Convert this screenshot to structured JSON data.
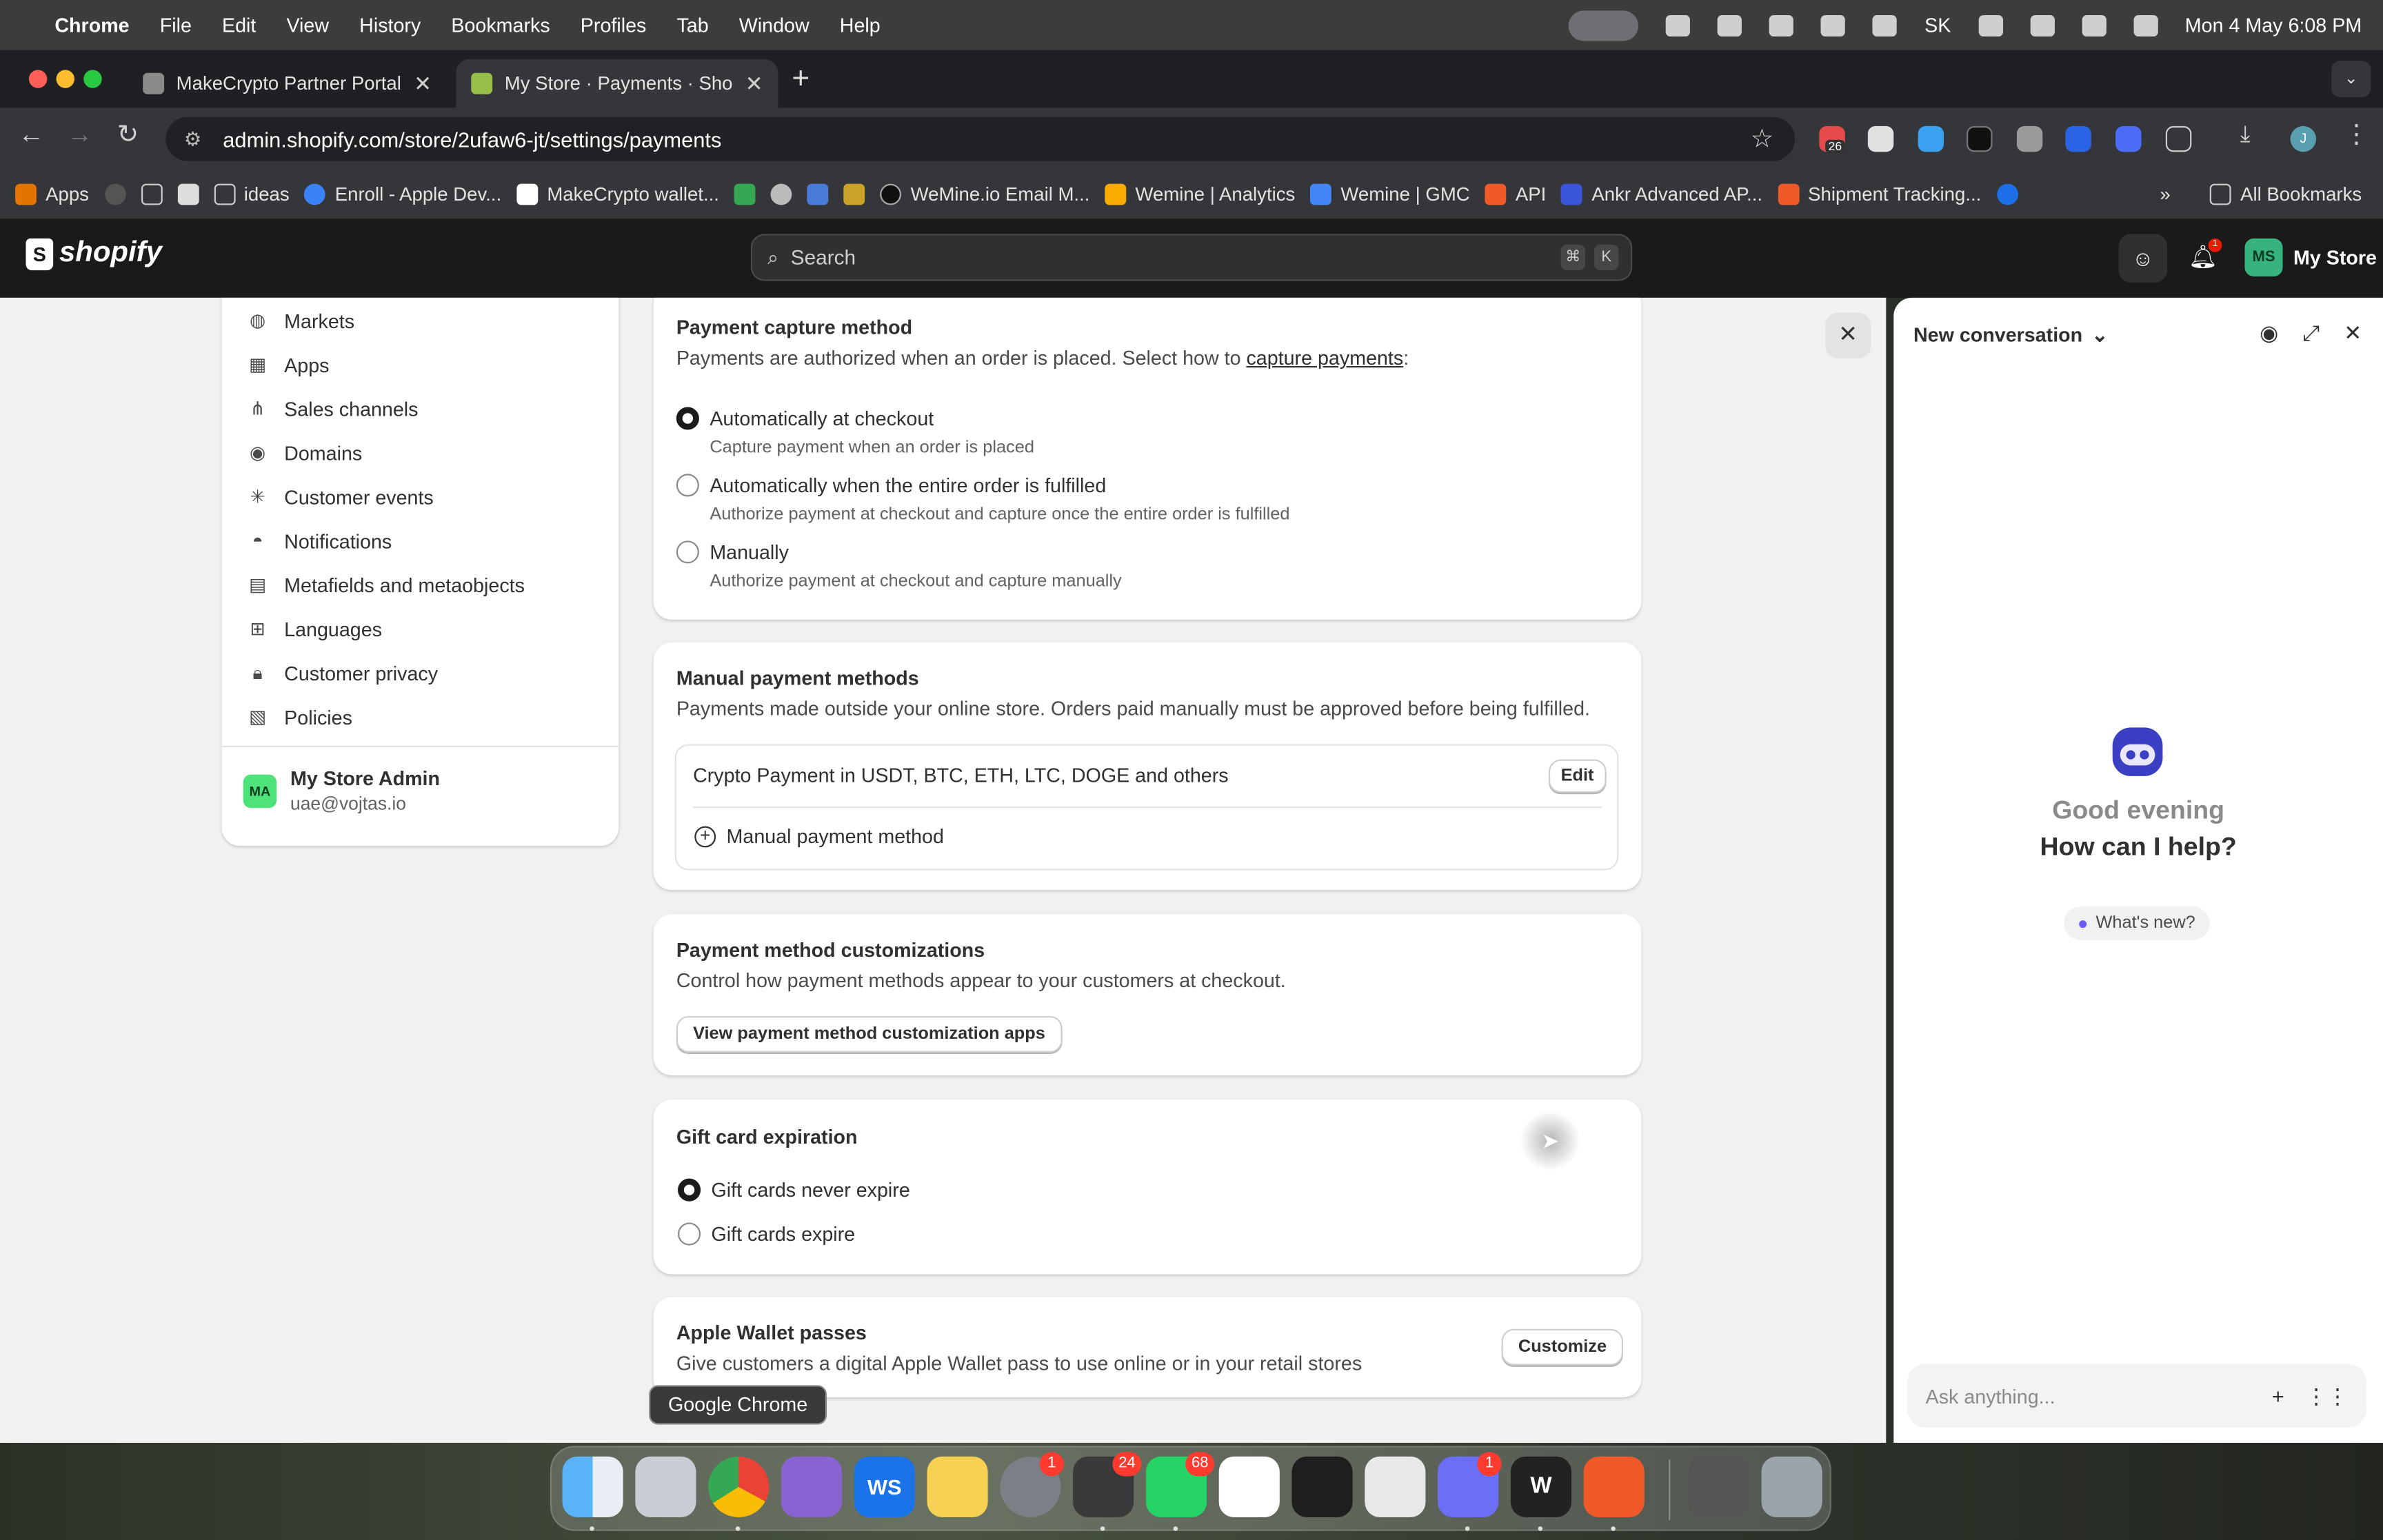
{
  "menubar": {
    "app": "Chrome",
    "items": [
      "File",
      "Edit",
      "View",
      "History",
      "Bookmarks",
      "Profiles",
      "Tab",
      "Window",
      "Help"
    ],
    "clock": "Mon 4 May  6:08 PM",
    "input_source": "SK"
  },
  "tabs": [
    {
      "title": "MakeCrypto Partner Portal"
    },
    {
      "title": "My Store · Payments · Shopify"
    }
  ],
  "address_bar": {
    "url": "admin.shopify.com/store/2ufaw6-jt/settings/payments"
  },
  "extensions": {
    "badge": "26"
  },
  "bookmarks": {
    "items": [
      "Apps",
      "ideas",
      "Enroll - Apple Dev...",
      "MakeCrypto wallet...",
      "WeMine.io Email M...",
      "Wemine | Analytics",
      "Wemine | GMC",
      "API",
      "Ankr Advanced AP...",
      "Shipment Tracking..."
    ],
    "all": "All Bookmarks"
  },
  "shopify": {
    "logo": "shopify",
    "search_placeholder": "Search",
    "shortcut": [
      "⌘",
      "K"
    ],
    "notifications_badge": "1",
    "store_initials": "MS",
    "store_name": "My Store"
  },
  "sidebar": {
    "items": [
      "Markets",
      "Apps",
      "Sales channels",
      "Domains",
      "Customer events",
      "Notifications",
      "Metafields and metaobjects",
      "Languages",
      "Customer privacy",
      "Policies"
    ],
    "admin": {
      "initials": "MA",
      "name": "My Store Admin",
      "email": "uae@vojtas.io"
    }
  },
  "capture": {
    "title": "Payment capture method",
    "desc_prefix": "Payments are authorized when an order is placed. Select how to ",
    "desc_link": "capture payments",
    "desc_suffix": ":",
    "options": [
      {
        "label": "Automatically at checkout",
        "help": "Capture payment when an order is placed",
        "selected": true
      },
      {
        "label": "Automatically when the entire order is fulfilled",
        "help": "Authorize payment at checkout and capture once the entire order is fulfilled",
        "selected": false
      },
      {
        "label": "Manually",
        "help": "Authorize payment at checkout and capture manually",
        "selected": false
      }
    ]
  },
  "manual": {
    "title": "Manual payment methods",
    "desc": "Payments made outside your online store. Orders paid manually must be approved before being fulfilled.",
    "method": "Crypto Payment in USDT, BTC, ETH, LTC, DOGE and others",
    "edit": "Edit",
    "add": "Manual payment method"
  },
  "customizations": {
    "title": "Payment method customizations",
    "desc": "Control how payment methods appear to your customers at checkout.",
    "button": "View payment method customization apps"
  },
  "giftcard": {
    "title": "Gift card expiration",
    "options": [
      {
        "label": "Gift cards never expire",
        "selected": true
      },
      {
        "label": "Gift cards expire",
        "selected": false
      }
    ]
  },
  "wallet": {
    "title": "Apple Wallet passes",
    "desc": "Give customers a digital Apple Wallet pass to use online or in your retail stores",
    "button": "Customize"
  },
  "sidekick": {
    "title": "New conversation",
    "greeting1": "Good evening",
    "greeting2": "How can I help?",
    "whats_new": "What's new?",
    "placeholder": "Ask anything..."
  },
  "dock": {
    "tooltip": "Google Chrome",
    "badges": {
      "settings": "1",
      "telegram": "24",
      "whatsapp": "68",
      "messenger": "1"
    }
  },
  "colors": {
    "accent": "#1a1a1a",
    "shopify_bar": "#1a1a1a",
    "bg": "#f1f1f1",
    "sidekick": "#3b3fc4"
  }
}
